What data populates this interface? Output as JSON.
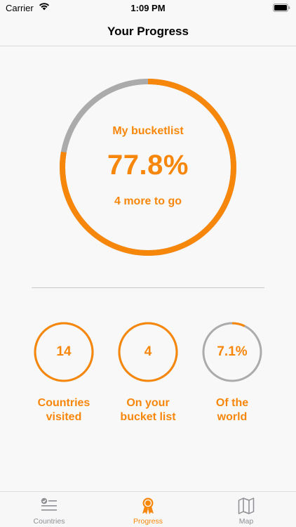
{
  "status_bar": {
    "carrier": "Carrier",
    "time": "1:09 PM"
  },
  "nav": {
    "title": "Your Progress"
  },
  "bucketlist_ring": {
    "label": "My bucketlist",
    "value": "77.8%",
    "progress_fraction": 0.778,
    "subtitle": "4 more to go"
  },
  "stats": [
    {
      "value": "14",
      "label_line1": "Countries",
      "label_line2": "visited",
      "progress_fraction": 1.0
    },
    {
      "value": "4",
      "label_line1": "On your",
      "label_line2": "bucket list",
      "progress_fraction": 1.0
    },
    {
      "value": "7.1%",
      "label_line1": "Of the",
      "label_line2": "world",
      "progress_fraction": 0.071
    }
  ],
  "tabs": [
    {
      "label": "Countries",
      "icon": "checklist-icon",
      "active": false
    },
    {
      "label": "Progress",
      "icon": "ribbon-award-icon",
      "active": true
    },
    {
      "label": "Map",
      "icon": "folded-map-icon",
      "active": false
    }
  ],
  "colors": {
    "accent": "#f7870b",
    "track": "#ababab",
    "inactive": "#8e8e93",
    "background": "#f9f8f8"
  }
}
